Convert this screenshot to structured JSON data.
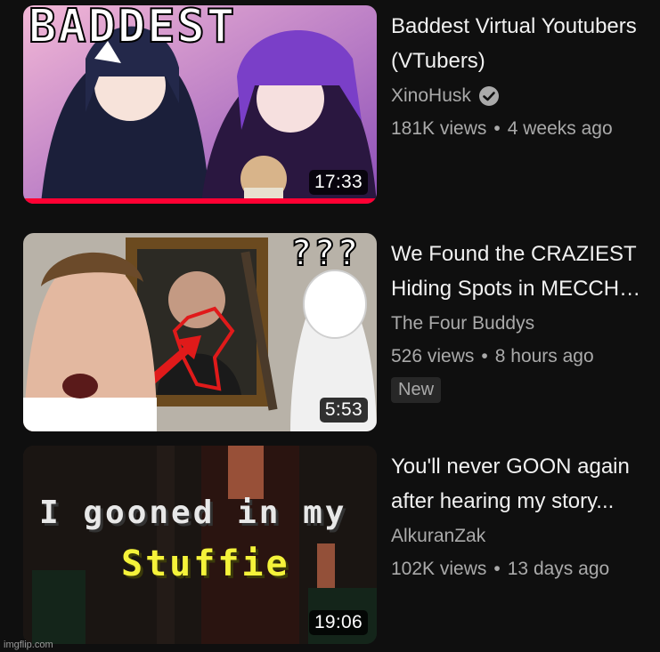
{
  "videos": [
    {
      "title": "Baddest Virtual Youtubers (VTubers)",
      "channel": "XinoHusk",
      "verified": true,
      "views": "181K views",
      "age": "4 weeks ago",
      "duration": "17:33",
      "watched_fraction": 1.0,
      "thumb_text": "BADDEST"
    },
    {
      "title": "We Found the CRAZIEST Hiding Spots in MECCH…",
      "channel": "The Four Buddys",
      "verified": false,
      "views": "526 views",
      "age": "8 hours ago",
      "badge": "New",
      "duration": "5:53",
      "thumb_text": "???"
    },
    {
      "title": "You'll never GOON again after hearing my story...",
      "channel": "AlkuranZak",
      "verified": false,
      "views": "102K views",
      "age": "13 days ago",
      "duration": "19:06",
      "thumb_line1": "I gooned in my",
      "thumb_line2": "Stuffie"
    }
  ],
  "separator": "•",
  "watermark": "imgflip.com",
  "colors": {
    "background": "#0f0f0f",
    "progress": "#ff0033",
    "muted": "#aaaaaa"
  }
}
